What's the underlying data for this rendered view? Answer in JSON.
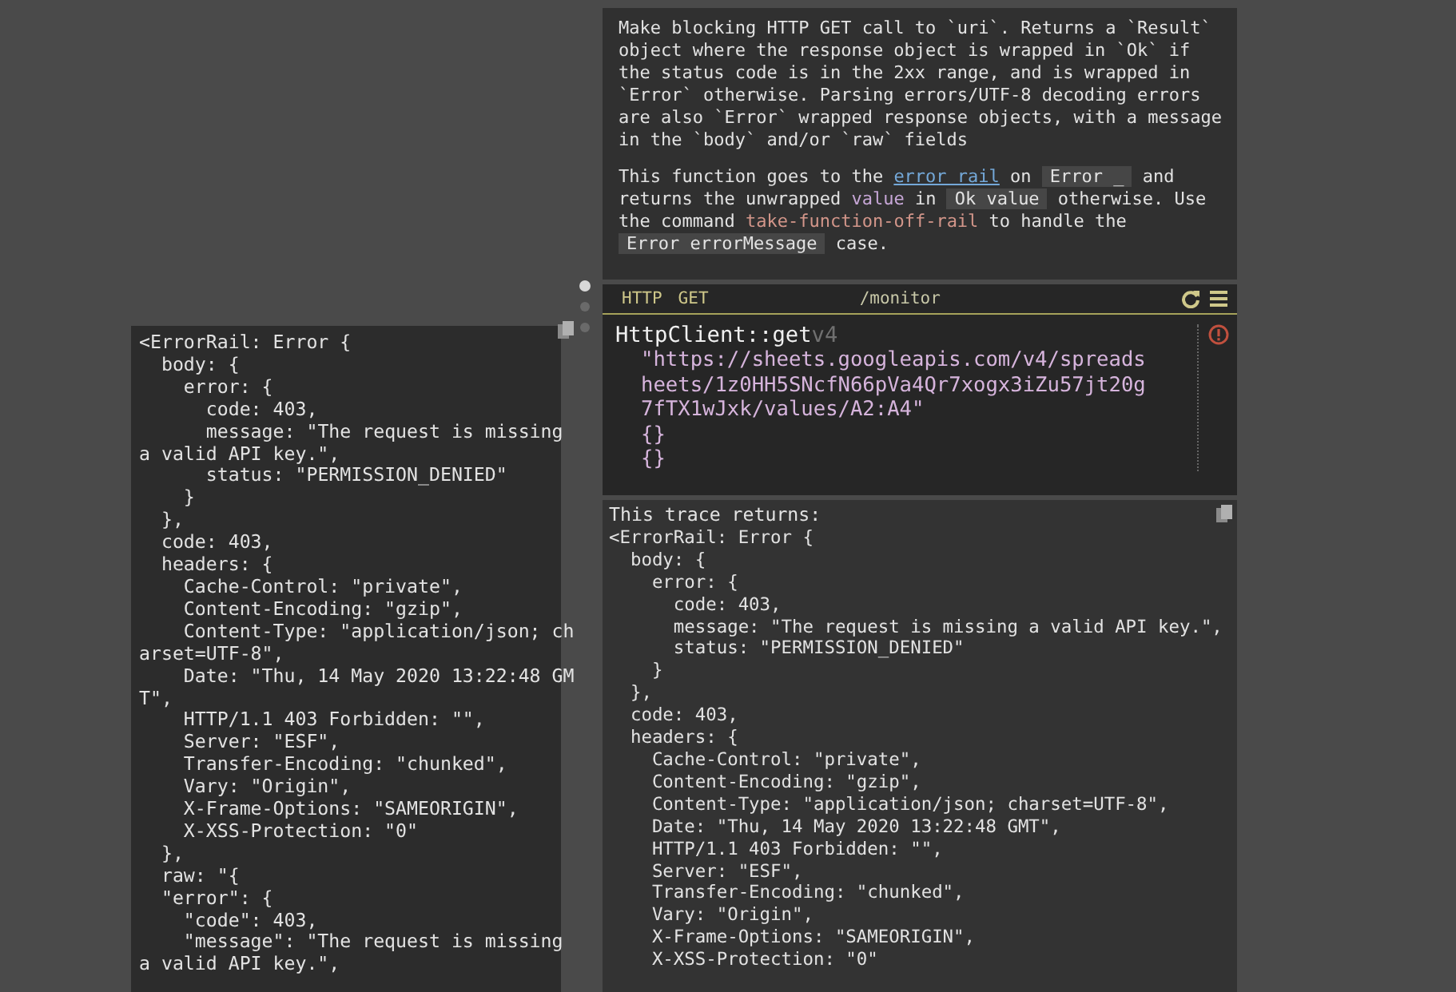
{
  "docs": {
    "paragraphs": [
      {
        "segments": [
          {
            "kind": "text",
            "text": "Make blocking HTTP GET call to `uri`. Returns a `Result` object where the response object is wrapped in `Ok` if the status code is in the 2xx range, and is wrapped in `Error` otherwise. Parsing errors/UTF-8 decoding errors are also `Error` wrapped response objects, with a message in the `body` and/or `raw` fields"
          }
        ]
      },
      {
        "segments": [
          {
            "kind": "text",
            "text": "This function goes to the "
          },
          {
            "kind": "link",
            "text": "error rail"
          },
          {
            "kind": "text",
            "text": " on "
          },
          {
            "kind": "code",
            "text": "Error _"
          },
          {
            "kind": "text",
            "text": " and returns the unwrapped "
          },
          {
            "kind": "variable",
            "text": "value"
          },
          {
            "kind": "text",
            "text": " in "
          },
          {
            "kind": "code",
            "text": "Ok value"
          },
          {
            "kind": "text",
            "text": " otherwise. Use the command "
          },
          {
            "kind": "command",
            "text": "take-function-off-rail"
          },
          {
            "kind": "text",
            "text": " to handle the "
          },
          {
            "kind": "code",
            "text": "Error errorMessage"
          },
          {
            "kind": "text",
            "text": " case."
          }
        ]
      }
    ]
  },
  "handler": {
    "labels": [
      "HTTP",
      "GET"
    ],
    "route": "/monitor",
    "function": "HttpClient::get",
    "version": "v4",
    "error": true,
    "arguments": [
      {
        "text": "\"https://sheets.googleapis.com/v4/spreadsheets/1z0HH5SNcfN66pVa4Qr7xogx3iZu57jt20g7fTX1wJxk/values/A2:A4\""
      },
      {
        "text": "{}"
      },
      {
        "text": "{}"
      }
    ]
  },
  "trace": {
    "caption": "This trace returns:",
    "lines": [
      "<ErrorRail: Error {",
      "  body: {",
      "    error: {",
      "      code: 403,",
      "      message: \"The request is missing a valid API key.\",",
      "      status: \"PERMISSION_DENIED\"",
      "    }",
      "  },",
      "  code: 403,",
      "  headers: {",
      "    Cache-Control: \"private\",",
      "    Content-Encoding: \"gzip\",",
      "    Content-Type: \"application/json; charset=UTF-8\",",
      "    Date: \"Thu, 14 May 2020 13:22:48 GMT\",",
      "    HTTP/1.1 403 Forbidden: \"\",",
      "    Server: \"ESF\",",
      "    Transfer-Encoding: \"chunked\",",
      "    Vary: \"Origin\",",
      "    X-Frame-Options: \"SAMEORIGIN\",",
      "    X-XSS-Protection: \"0\""
    ]
  },
  "result_panel": {
    "lines": [
      "<ErrorRail: Error {",
      "  body: {",
      "    error: {",
      "      code: 403,",
      "      message: \"The request is missing a valid API key.\",",
      "      status: \"PERMISSION_DENIED\"",
      "    }",
      "  },",
      "  code: 403,",
      "  headers: {",
      "    Cache-Control: \"private\",",
      "    Content-Encoding: \"gzip\",",
      "    Content-Type: \"application/json; charset=UTF-8\",",
      "    Date: \"Thu, 14 May 2020 13:22:48 GMT\",",
      "    HTTP/1.1 403 Forbidden: \"\",",
      "    Server: \"ESF\",",
      "    Transfer-Encoding: \"chunked\",",
      "    Vary: \"Origin\",",
      "    X-Frame-Options: \"SAMEORIGIN\",",
      "    X-XSS-Protection: \"0\"",
      "  },",
      "  raw: \"{",
      "  \"error\": {",
      "    \"code\": 403,",
      "    \"message\": \"The request is missing a valid API key.\","
    ]
  }
}
